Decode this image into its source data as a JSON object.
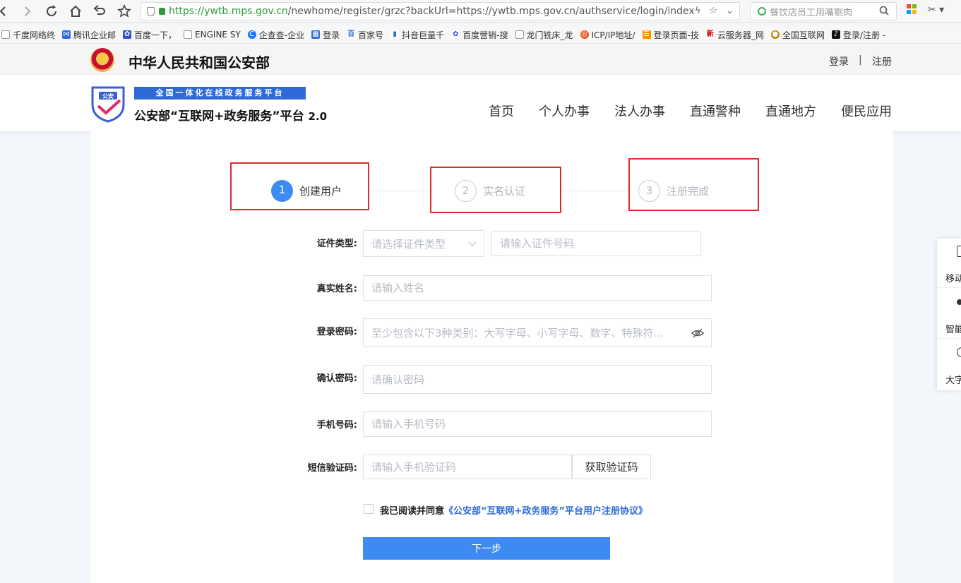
{
  "browser": {
    "url_scheme_host": "https://ywtb.mps.gov.cn",
    "url_path": "/newhome/register/grzc?backUrl=https://ywtb.mps.gov.cn/authservice/login/index",
    "search_text": "餐饮店员工用嘴剔肉",
    "bookmarks": [
      "千度网络终",
      "腾讯企业邮",
      "百度一下，",
      "ENGINE SY",
      "企查查-企业",
      "登录",
      "百家号",
      "抖音巨量千",
      "百度营销-搜",
      "龙门铣床_龙",
      "ICP/IP地址/",
      "登录页面-技",
      "云服务器_网",
      "全国互联网",
      "登录/注册 -"
    ]
  },
  "site": {
    "title": "中华人民共和国公安部",
    "login": "登录",
    "separator": "|",
    "register": "注册",
    "brand_tag": "全国一体化在线政务服务平台",
    "brand_name": "公安部“互联网+政务服务”平台",
    "brand_version": "2.0",
    "logo_text": "公安",
    "nav": [
      "首页",
      "个人办事",
      "法人办事",
      "直通警种",
      "直通地方",
      "便民应用"
    ]
  },
  "steps": [
    {
      "num": "1",
      "label": "创建用户",
      "active": true
    },
    {
      "num": "2",
      "label": "实名认证",
      "active": false
    },
    {
      "num": "3",
      "label": "注册完成",
      "active": false
    }
  ],
  "form": {
    "id_type_label": "证件类型:",
    "id_type_placeholder": "请选择证件类型",
    "id_number_placeholder": "请输入证件号码",
    "name_label": "真实姓名:",
    "name_placeholder": "请输入姓名",
    "password_label": "登录密码:",
    "password_placeholder": "至少包含以下3种类别：大写字母、小写字母、数字、特殊符...",
    "confirm_label": "确认密码:",
    "confirm_placeholder": "请确认密码",
    "phone_label": "手机号码:",
    "phone_placeholder": "请输入手机号码",
    "sms_label": "短信验证码:",
    "sms_placeholder": "请输入手机验证码",
    "sms_button": "获取验证码",
    "agree_prefix": "我已阅读并同意",
    "agree_link": "《公安部“互联网+政务服务”平台用户注册协议》",
    "next_button": "下一步"
  },
  "side_panel": [
    "移动",
    "智能",
    "大字"
  ],
  "colors": {
    "primary": "#3d8bf2",
    "highlight": "#e02a2a",
    "brand": "#2f6ad8"
  }
}
